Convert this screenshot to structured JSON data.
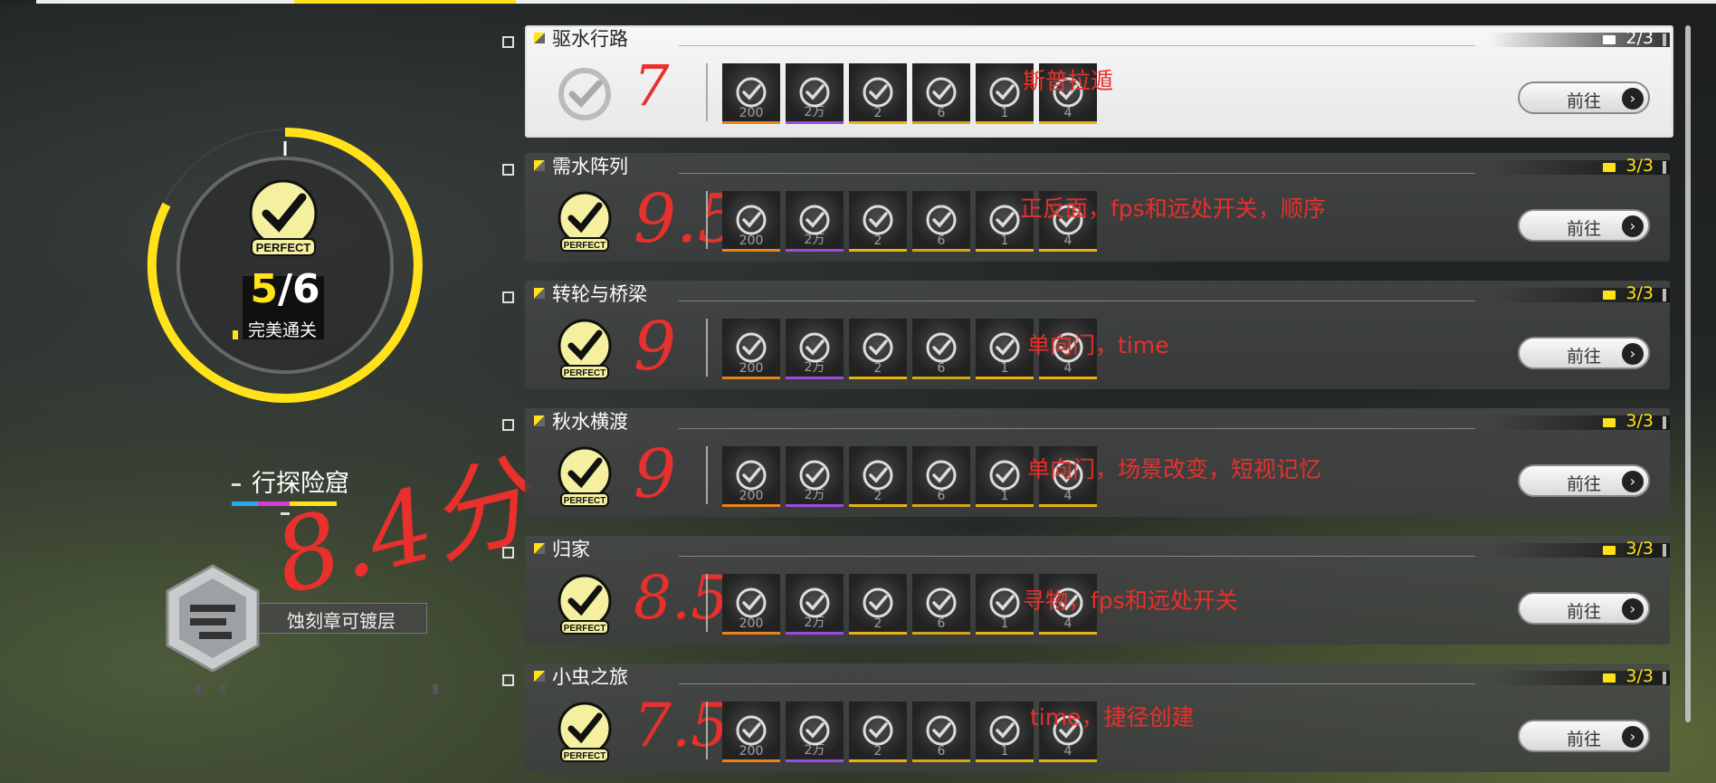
{
  "topbar": {
    "accent": "#ffe21a"
  },
  "summary": {
    "medal_text": "PERFECT",
    "cleared": "5",
    "total": "/6",
    "status": "完美通关",
    "region_name": "行探险窟",
    "badge_label": "蚀刻章可镀层"
  },
  "annotation": {
    "overall_score": "8.4分"
  },
  "levels": [
    {
      "name": "驱水行路",
      "progress": "2/3",
      "medal": "",
      "score": "7",
      "note": "斯普拉遁",
      "go_label": "前往",
      "selected": true
    },
    {
      "name": "需水阵列",
      "progress": "3/3",
      "medal": "PERFECT",
      "score": "9.5",
      "note": "正反面，fps和远处开关，顺序",
      "go_label": "前往",
      "selected": false
    },
    {
      "name": "转轮与桥梁",
      "progress": "3/3",
      "medal": "PERFECT",
      "score": "9",
      "note": "单向门，time",
      "go_label": "前往",
      "selected": false
    },
    {
      "name": "秋水横渡",
      "progress": "3/3",
      "medal": "PERFECT",
      "score": "9",
      "note": "单向门，场景改变，短视记忆",
      "go_label": "前往",
      "selected": false
    },
    {
      "name": "归家",
      "progress": "3/3",
      "medal": "PERFECT",
      "score": "8.5",
      "note": "寻物，fps和远处开关",
      "go_label": "前往",
      "selected": false
    },
    {
      "name": "小虫之旅",
      "progress": "3/3",
      "medal": "PERFECT",
      "score": "7.5",
      "note": "time，捷径创建",
      "go_label": "前往",
      "selected": false
    }
  ],
  "item_counts": [
    "200",
    "2万",
    "2",
    "6",
    "1",
    "4"
  ],
  "colors": {
    "highlight": "#ffe21a",
    "annotation": "#e8302c"
  }
}
